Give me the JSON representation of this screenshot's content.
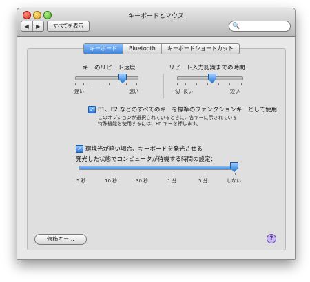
{
  "window": {
    "title": "キーボードとマウス"
  },
  "toolbar": {
    "back_icon": "◀",
    "forward_icon": "▶",
    "show_all_label": "すべてを表示",
    "search_icon": "🔍",
    "search_value": ""
  },
  "tabs": [
    {
      "label": "キーボード",
      "active": true
    },
    {
      "label": "Bluetooth",
      "active": false
    },
    {
      "label": "キーボードショートカット",
      "active": false
    }
  ],
  "key_repeat": {
    "label": "キーのリピート速度",
    "left_label": "遅い",
    "right_label": "速い",
    "value_fraction": 0.85
  },
  "repeat_delay": {
    "label": "リピート入力認識までの時間",
    "left_label": "切",
    "mid_label": "長い",
    "right_label": "短い",
    "value_fraction": 0.72
  },
  "fn_keys": {
    "checked": true,
    "label": "F1、F2 などのすべてのキーを標準のファンクションキーとして使用",
    "note_line1": "このオプションが選択されているときに、各キーに示されている",
    "note_line2": "特殊機能を使用するには、Fn キーを押します。"
  },
  "backlight": {
    "checked": true,
    "label": "環境光が暗い場合、キーボードを発光させる",
    "timeout_label": "発光した状態でコンピュータが待機する時間の設定：",
    "tick_labels": [
      "5 秒",
      "10 秒",
      "30 秒",
      "1 分",
      "5 分",
      "しない"
    ],
    "value_fraction": 1.0
  },
  "footer": {
    "modifiers_label": "修飾キー...",
    "help_icon": "?"
  }
}
